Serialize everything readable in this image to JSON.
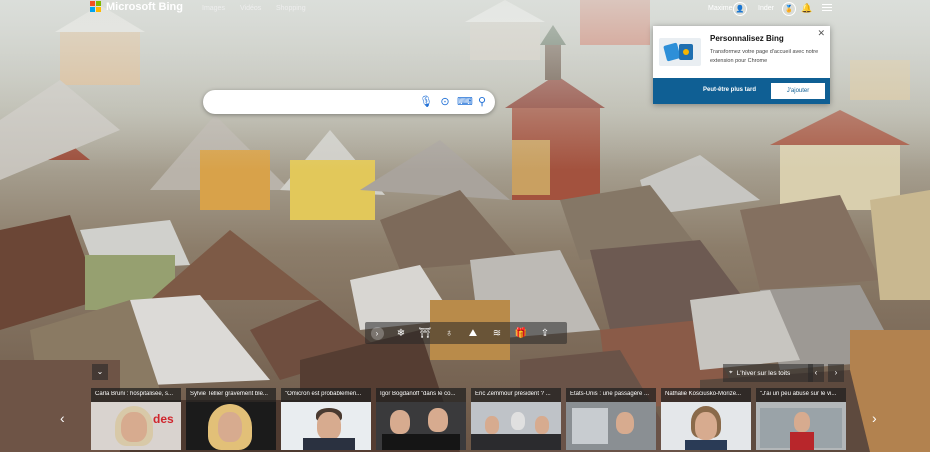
{
  "header": {
    "logo_text": "Microsoft Bing",
    "nav": [
      "Images",
      "Vidéos",
      "Shopping"
    ],
    "user_label": "Maxime",
    "points": "Inder",
    "points_icon": "medal-icon",
    "bell_icon": "bell-icon",
    "menu_icon": "hamburger-icon"
  },
  "search": {
    "placeholder": "",
    "icons": [
      "mic-icon",
      "visual-search-icon",
      "keyboard-icon",
      "search-icon"
    ]
  },
  "popup": {
    "title": "Personnalisez Bing",
    "description": "Transformez votre page d'accueil avec notre extension pour Chrome",
    "later_label": "Peut-être plus tard",
    "add_label": "J'ajouter",
    "close_label": "✕"
  },
  "toolbar": {
    "items": [
      "›",
      "❄",
      "⛩",
      "♁",
      "⛰",
      "≋",
      "🎁",
      "⇪"
    ]
  },
  "image_info": {
    "collapse_label": "⌄",
    "location_text": "L'hiver sur les toits",
    "prev": "‹",
    "next": "›"
  },
  "news": {
    "prev_arrow": "‹",
    "next_arrow": "›",
    "items": [
      {
        "title": "Carla Bruni : hospitalisée, s..."
      },
      {
        "title": "Sylvie Tellier gravement ble..."
      },
      {
        "title": "\"Omicron est probablemen..."
      },
      {
        "title": "Igor Bogdanoff \"dans le co..."
      },
      {
        "title": "Éric Zemmour président ? ..."
      },
      {
        "title": "Etats-Unis : une passagère ..."
      },
      {
        "title": "Nathalie Kosciusko-Morize..."
      },
      {
        "title": "\"J'ai un peu abusé sur le vi..."
      }
    ]
  },
  "colors": {
    "accent": "#0f5f94",
    "search_icon": "#1f6fd6"
  }
}
